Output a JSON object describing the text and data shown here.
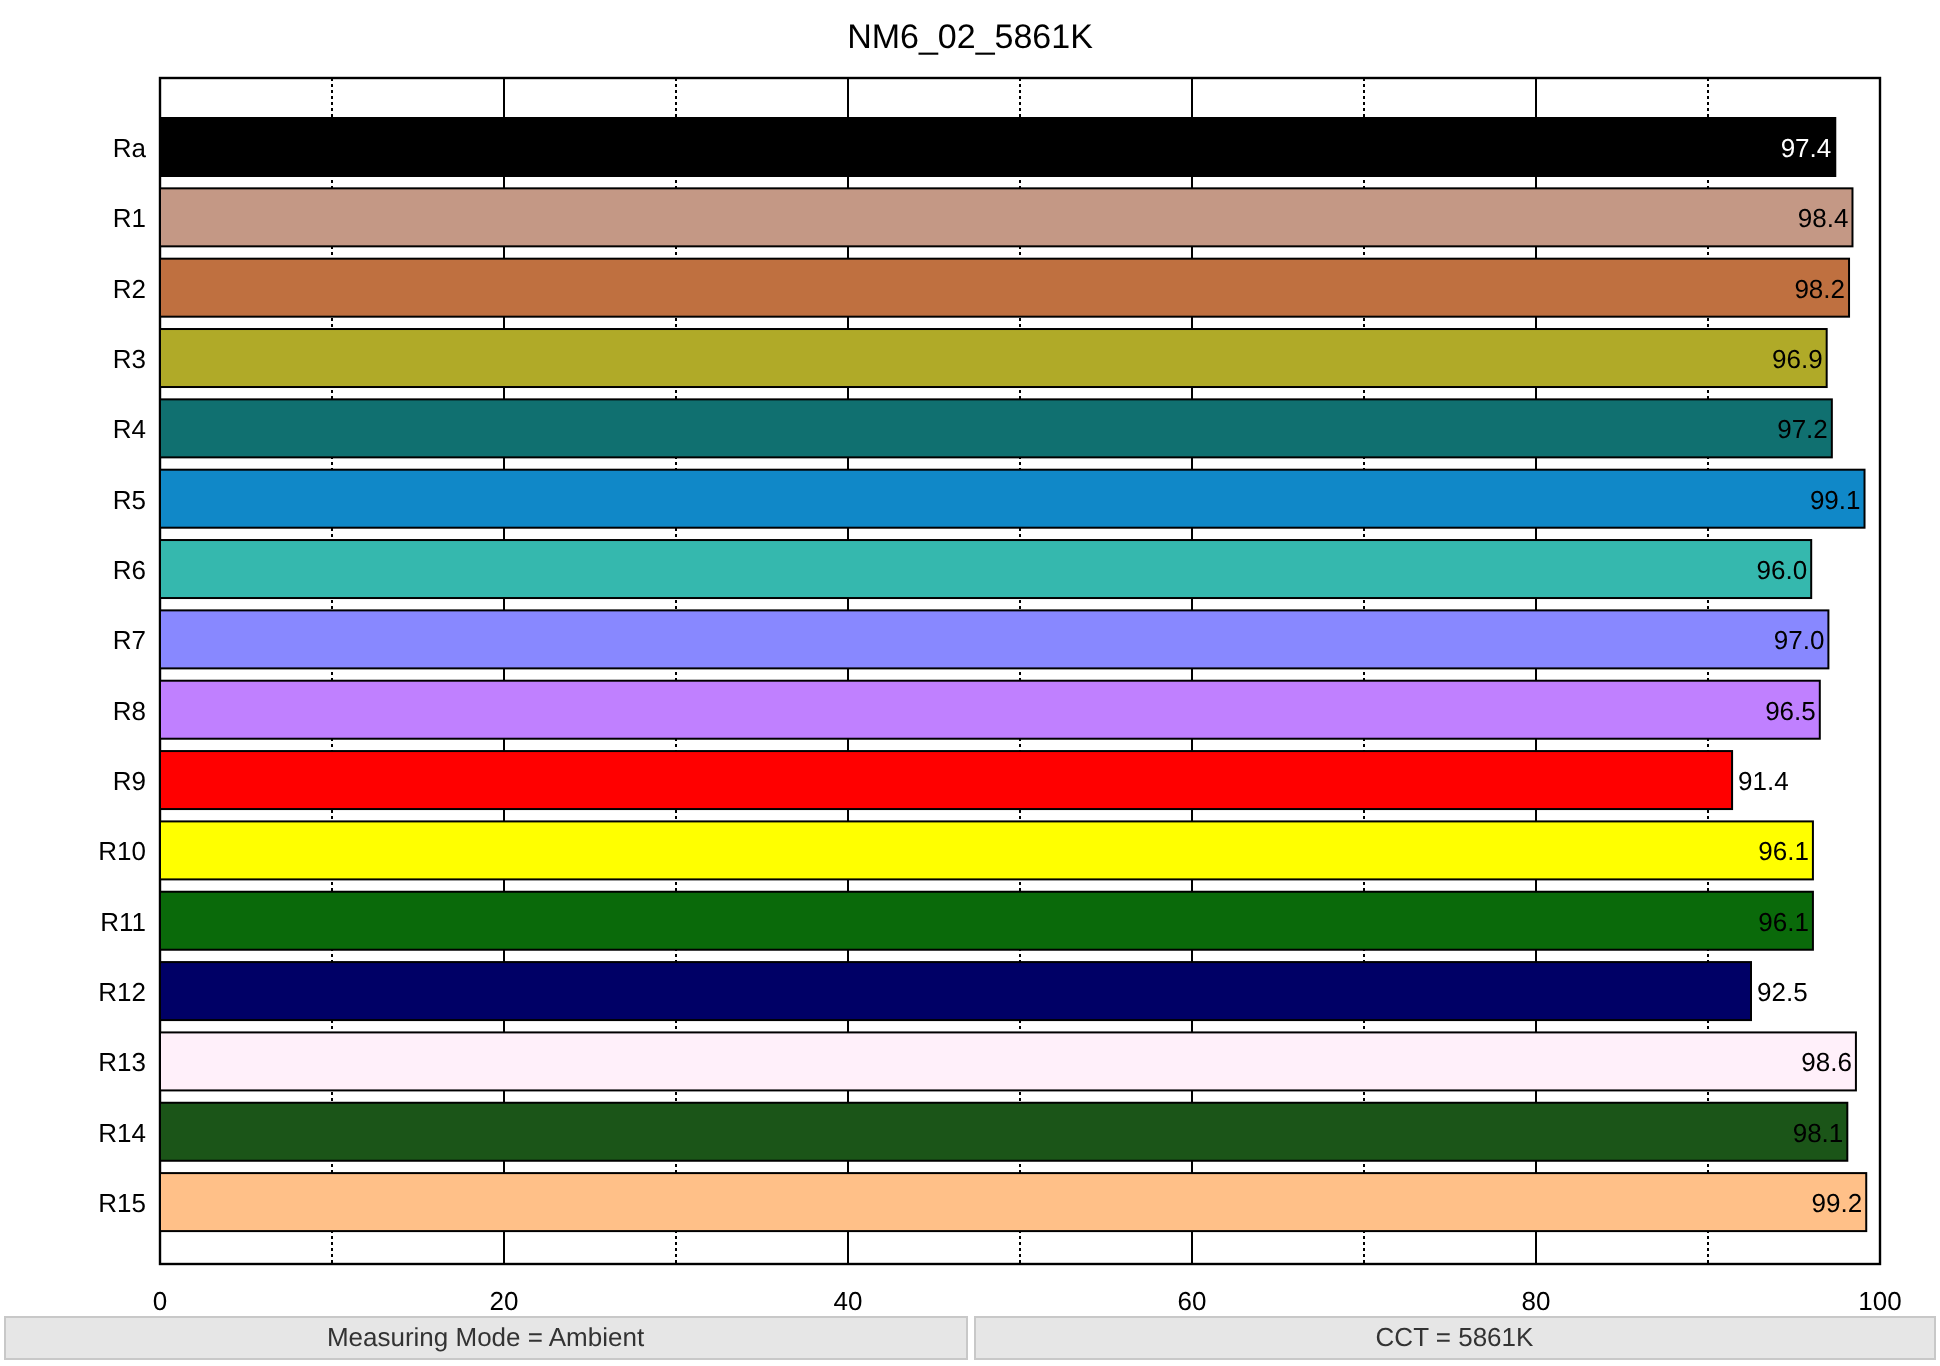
{
  "chart_data": {
    "type": "bar",
    "orientation": "horizontal",
    "title": "NM6_02_5861K",
    "categories": [
      "Ra",
      "R1",
      "R2",
      "R3",
      "R4",
      "R5",
      "R6",
      "R7",
      "R8",
      "R9",
      "R10",
      "R11",
      "R12",
      "R13",
      "R14",
      "R15"
    ],
    "series": [
      {
        "color": "#000000",
        "values": [
          97.4,
          null,
          null,
          null,
          null,
          null,
          null,
          null,
          null,
          null,
          null,
          null,
          null,
          null,
          null,
          null
        ]
      },
      {
        "color": "#c49885",
        "values": [
          null,
          98.4,
          null,
          null,
          null,
          null,
          null,
          null,
          null,
          null,
          null,
          null,
          null,
          null,
          null,
          null
        ]
      },
      {
        "color": "#bf7040",
        "values": [
          null,
          null,
          98.2,
          null,
          null,
          null,
          null,
          null,
          null,
          null,
          null,
          null,
          null,
          null,
          null,
          null
        ]
      },
      {
        "color": "#b0aa28",
        "values": [
          null,
          null,
          null,
          96.9,
          null,
          null,
          null,
          null,
          null,
          null,
          null,
          null,
          null,
          null,
          null,
          null
        ]
      },
      {
        "color": "#107070",
        "values": [
          null,
          null,
          null,
          null,
          97.2,
          null,
          null,
          null,
          null,
          null,
          null,
          null,
          null,
          null,
          null,
          null
        ]
      },
      {
        "color": "#1088c8",
        "values": [
          null,
          null,
          null,
          null,
          null,
          99.1,
          null,
          null,
          null,
          null,
          null,
          null,
          null,
          null,
          null,
          null
        ]
      },
      {
        "color": "#35b8ae",
        "values": [
          null,
          null,
          null,
          null,
          null,
          null,
          96.0,
          null,
          null,
          null,
          null,
          null,
          null,
          null,
          null,
          null
        ]
      },
      {
        "color": "#8888ff",
        "values": [
          null,
          null,
          null,
          null,
          null,
          null,
          null,
          97.0,
          null,
          null,
          null,
          null,
          null,
          null,
          null,
          null
        ]
      },
      {
        "color": "#c080ff",
        "values": [
          null,
          null,
          null,
          null,
          null,
          null,
          null,
          null,
          96.5,
          null,
          null,
          null,
          null,
          null,
          null,
          null
        ]
      },
      {
        "color": "#ff0000",
        "values": [
          null,
          null,
          null,
          null,
          null,
          null,
          null,
          null,
          null,
          91.4,
          null,
          null,
          null,
          null,
          null,
          null
        ]
      },
      {
        "color": "#ffff00",
        "values": [
          null,
          null,
          null,
          null,
          null,
          null,
          null,
          null,
          null,
          null,
          96.1,
          null,
          null,
          null,
          null,
          null
        ]
      },
      {
        "color": "#0a6a0a",
        "values": [
          null,
          null,
          null,
          null,
          null,
          null,
          null,
          null,
          null,
          null,
          null,
          96.1,
          null,
          null,
          null,
          null
        ]
      },
      {
        "color": "#000066",
        "values": [
          null,
          null,
          null,
          null,
          null,
          null,
          null,
          null,
          null,
          null,
          null,
          null,
          92.5,
          null,
          null,
          null
        ]
      },
      {
        "color": "#fff0fa",
        "values": [
          null,
          null,
          null,
          null,
          null,
          null,
          null,
          null,
          null,
          null,
          null,
          null,
          null,
          98.6,
          null,
          null
        ]
      },
      {
        "color": "#1b5518",
        "values": [
          null,
          null,
          null,
          null,
          null,
          null,
          null,
          null,
          null,
          null,
          null,
          null,
          null,
          null,
          98.1,
          null
        ]
      },
      {
        "color": "#ffc088",
        "values": [
          null,
          null,
          null,
          null,
          null,
          null,
          null,
          null,
          null,
          null,
          null,
          null,
          null,
          null,
          null,
          99.2
        ]
      }
    ],
    "value_labels": [
      "97.4",
      "98.4",
      "98.2",
      "96.9",
      "97.2",
      "99.1",
      "96.0",
      "97.0",
      "96.5",
      "91.4",
      "96.1",
      "96.1",
      "92.5",
      "98.6",
      "98.1",
      "99.2"
    ],
    "xlim": [
      0,
      100
    ],
    "xticks": [
      0,
      20,
      40,
      60,
      80,
      100
    ],
    "grid": true
  },
  "status_bar": [
    {
      "text": "Measuring Mode = Ambient"
    },
    {
      "text": "CCT = 5861K"
    }
  ]
}
